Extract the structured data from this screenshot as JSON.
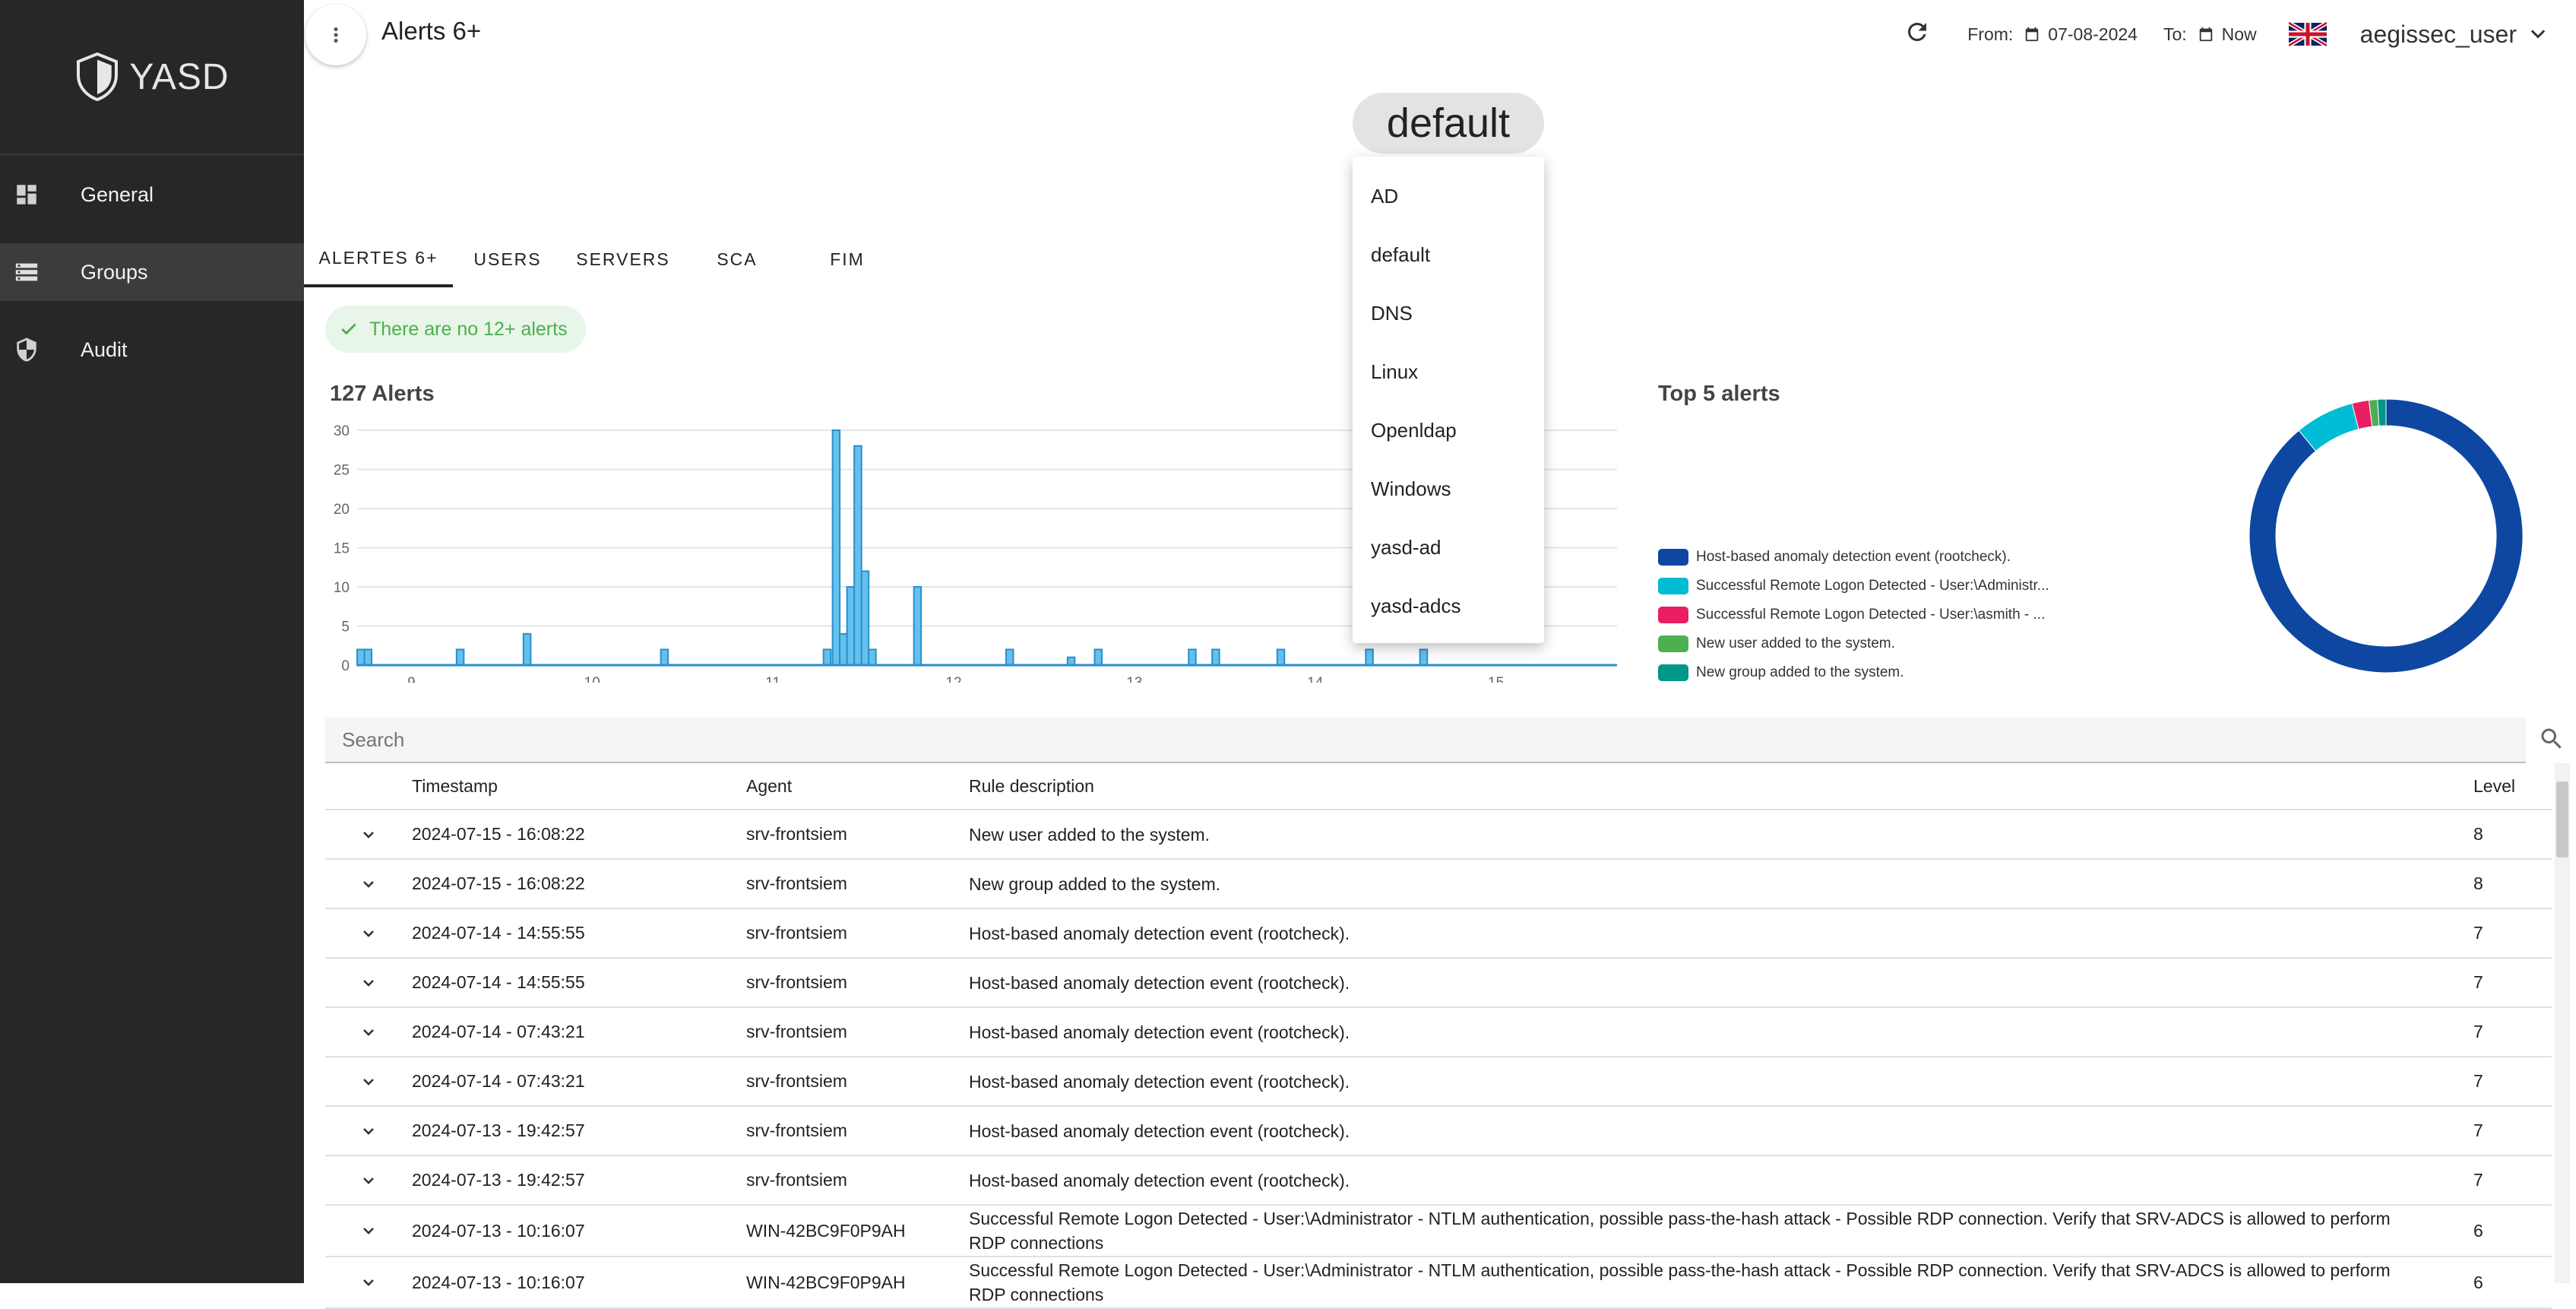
{
  "app": {
    "brand": "YASD"
  },
  "sidebar": {
    "items": [
      {
        "label": "General",
        "icon": "dashboard-icon"
      },
      {
        "label": "Groups",
        "icon": "storage-icon",
        "active": true
      },
      {
        "label": "Audit",
        "icon": "shield-icon"
      }
    ]
  },
  "header": {
    "title": "Alerts 6+",
    "from_label": "From:",
    "from_value": "07-08-2024",
    "to_label": "To:",
    "to_value": "Now",
    "user": "aegissec_user"
  },
  "group_selector": {
    "selected": "default",
    "options": [
      "AD",
      "default",
      "DNS",
      "Linux",
      "Openldap",
      "Windows",
      "yasd-ad",
      "yasd-adcs"
    ]
  },
  "tabs": [
    {
      "label": "ALERTES 6+",
      "active": true
    },
    {
      "label": "USERS"
    },
    {
      "label": "SERVERS"
    },
    {
      "label": "SCA"
    },
    {
      "label": "FIM"
    }
  ],
  "status_chip": "There are no 12+ alerts",
  "chart_title": "127 Alerts",
  "top5_title": "Top 5 alerts",
  "chart_data": [
    {
      "type": "bar",
      "title": "127 Alerts",
      "x_ticks": [
        "9",
        "10",
        "11",
        "12",
        "13",
        "14",
        "15"
      ],
      "y_ticks": [
        0,
        5,
        10,
        15,
        20,
        25,
        30
      ],
      "ylim": [
        0,
        30
      ],
      "xlim": [
        8.7,
        15.67
      ],
      "bins": [
        {
          "x": 8.72,
          "v": 2
        },
        {
          "x": 8.76,
          "v": 2
        },
        {
          "x": 9.27,
          "v": 2
        },
        {
          "x": 9.64,
          "v": 4
        },
        {
          "x": 10.4,
          "v": 2
        },
        {
          "x": 11.3,
          "v": 2
        },
        {
          "x": 11.35,
          "v": 30
        },
        {
          "x": 11.39,
          "v": 4
        },
        {
          "x": 11.43,
          "v": 10
        },
        {
          "x": 11.47,
          "v": 28
        },
        {
          "x": 11.51,
          "v": 12
        },
        {
          "x": 11.55,
          "v": 2
        },
        {
          "x": 11.8,
          "v": 10
        },
        {
          "x": 12.31,
          "v": 2
        },
        {
          "x": 12.65,
          "v": 1
        },
        {
          "x": 12.8,
          "v": 2
        },
        {
          "x": 13.32,
          "v": 2
        },
        {
          "x": 13.45,
          "v": 2
        },
        {
          "x": 13.81,
          "v": 2
        },
        {
          "x": 14.3,
          "v": 2
        },
        {
          "x": 14.6,
          "v": 2
        }
      ]
    },
    {
      "type": "pie",
      "title": "Top 5 alerts",
      "slices": [
        {
          "label": "Host-based anomaly detection event (rootcheck).",
          "value": 89,
          "color": "#0d47a1"
        },
        {
          "label": "Successful Remote Logon Detected - User:\\Administr...",
          "value": 7,
          "color": "#00bcd4"
        },
        {
          "label": "Successful Remote Logon Detected - User:\\asmith - ...",
          "value": 2,
          "color": "#e91e63"
        },
        {
          "label": "New user added to the system.",
          "value": 1,
          "color": "#4caf50"
        },
        {
          "label": "New group added to the system.",
          "value": 1,
          "color": "#009688"
        }
      ]
    }
  ],
  "search": {
    "placeholder": "Search"
  },
  "table": {
    "headers": {
      "timestamp": "Timestamp",
      "agent": "Agent",
      "description": "Rule description",
      "level": "Level"
    },
    "rows": [
      {
        "ts": "2024-07-15 - 16:08:22",
        "agent": "srv-frontsiem",
        "desc": "New user added to the system.",
        "level": "8"
      },
      {
        "ts": "2024-07-15 - 16:08:22",
        "agent": "srv-frontsiem",
        "desc": "New group added to the system.",
        "level": "8"
      },
      {
        "ts": "2024-07-14 - 14:55:55",
        "agent": "srv-frontsiem",
        "desc": "Host-based anomaly detection event (rootcheck).",
        "level": "7"
      },
      {
        "ts": "2024-07-14 - 14:55:55",
        "agent": "srv-frontsiem",
        "desc": "Host-based anomaly detection event (rootcheck).",
        "level": "7"
      },
      {
        "ts": "2024-07-14 - 07:43:21",
        "agent": "srv-frontsiem",
        "desc": "Host-based anomaly detection event (rootcheck).",
        "level": "7"
      },
      {
        "ts": "2024-07-14 - 07:43:21",
        "agent": "srv-frontsiem",
        "desc": "Host-based anomaly detection event (rootcheck).",
        "level": "7"
      },
      {
        "ts": "2024-07-13 - 19:42:57",
        "agent": "srv-frontsiem",
        "desc": "Host-based anomaly detection event (rootcheck).",
        "level": "7"
      },
      {
        "ts": "2024-07-13 - 19:42:57",
        "agent": "srv-frontsiem",
        "desc": "Host-based anomaly detection event (rootcheck).",
        "level": "7"
      },
      {
        "ts": "2024-07-13 - 10:16:07",
        "agent": "WIN-42BC9F0P9AH",
        "desc": "Successful Remote Logon Detected - User:\\Administrator - NTLM authentication, possible pass-the-hash attack - Possible RDP connection. Verify that SRV-ADCS is allowed to perform RDP connections",
        "level": "6"
      },
      {
        "ts": "2024-07-13 - 10:16:07",
        "agent": "WIN-42BC9F0P9AH",
        "desc": "Successful Remote Logon Detected - User:\\Administrator - NTLM authentication, possible pass-the-hash attack - Possible RDP connection. Verify that SRV-ADCS is allowed to perform RDP connections",
        "level": "6"
      }
    ]
  }
}
